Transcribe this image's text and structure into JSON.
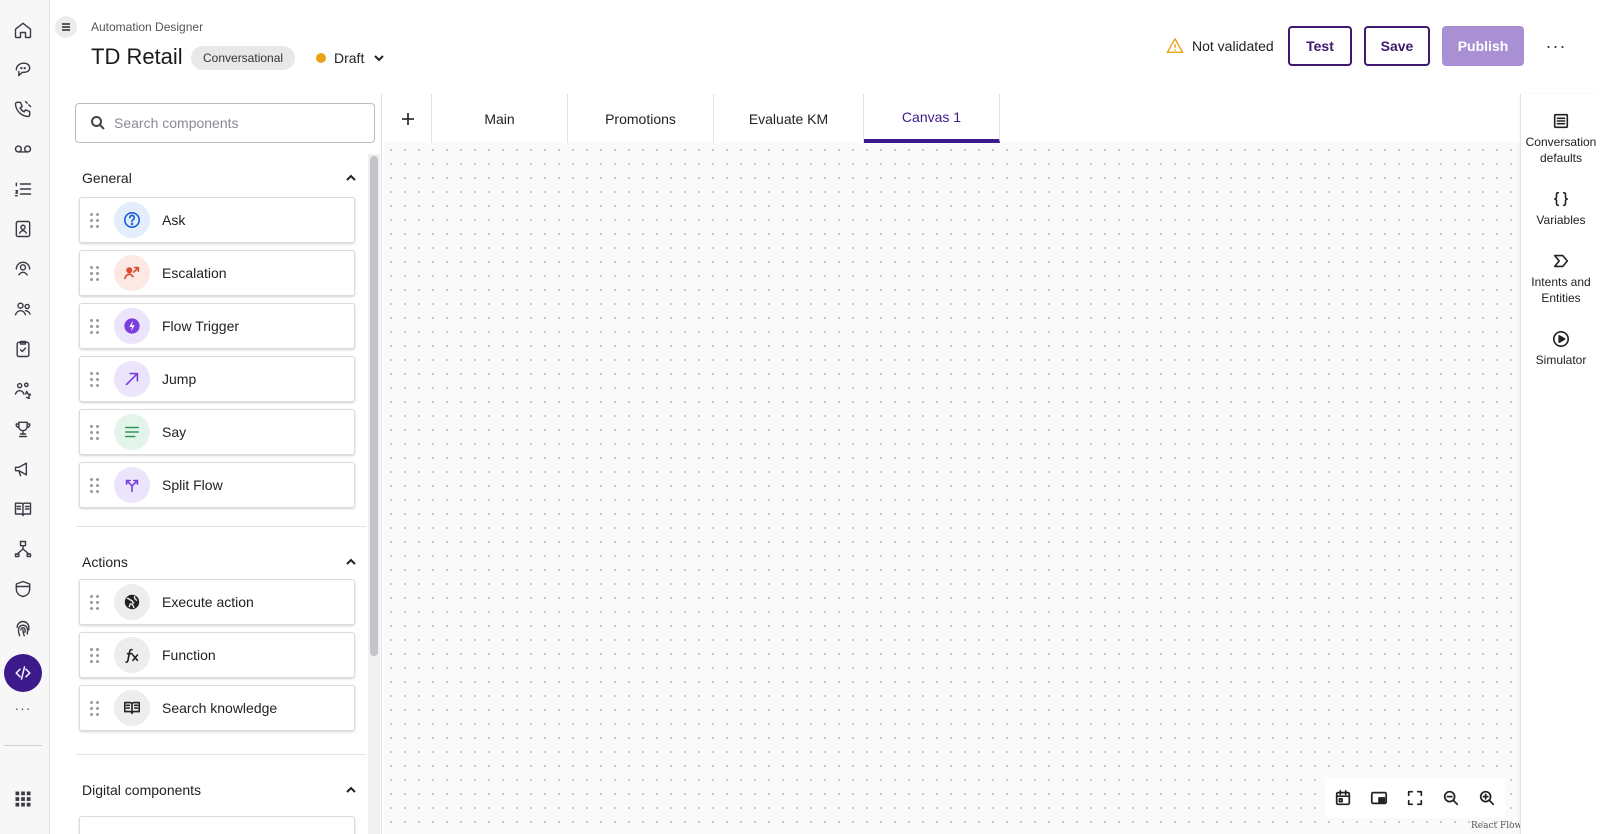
{
  "header": {
    "breadcrumb": "Automation Designer",
    "title": "TD Retail",
    "type_chip": "Conversational",
    "status": "Draft",
    "validation": "Not validated",
    "test_label": "Test",
    "save_label": "Save",
    "publish_label": "Publish",
    "more_label": "···"
  },
  "colors": {
    "brand": "#3d1a8c",
    "publish_disabled": "#a98fd3",
    "draft_dot": "#e8a317",
    "warning": "#e8a317"
  },
  "search": {
    "placeholder": "Search components",
    "value": ""
  },
  "sections": [
    {
      "title": "General",
      "items": [
        {
          "label": "Ask",
          "icon": "question-circle-icon",
          "color": "#1a5fd6",
          "bg": "#e4edfb"
        },
        {
          "label": "Escalation",
          "icon": "escalation-icon",
          "color": "#e0492b",
          "bg": "#fde9e4"
        },
        {
          "label": "Flow Trigger",
          "icon": "lightning-icon",
          "color": "#7a3de0",
          "bg": "#ece4fb"
        },
        {
          "label": "Jump",
          "icon": "arrow-up-right-icon",
          "color": "#7a3de0",
          "bg": "#ece4fb"
        },
        {
          "label": "Say",
          "icon": "text-lines-icon",
          "color": "#2e9a5a",
          "bg": "#e3f4ea"
        },
        {
          "label": "Split Flow",
          "icon": "split-icon",
          "color": "#7a3de0",
          "bg": "#ece4fb"
        }
      ]
    },
    {
      "title": "Actions",
      "items": [
        {
          "label": "Execute action",
          "icon": "globe-icon",
          "color": "#222222",
          "bg": "#ededef"
        },
        {
          "label": "Function",
          "icon": "function-icon",
          "color": "#222222",
          "bg": "#ededef"
        },
        {
          "label": "Search knowledge",
          "icon": "book-icon",
          "color": "#222222",
          "bg": "#ededef"
        }
      ]
    },
    {
      "title": "Digital components",
      "items": []
    }
  ],
  "tabs": [
    {
      "label": "Main",
      "active": false
    },
    {
      "label": "Promotions",
      "active": false
    },
    {
      "label": "Evaluate KM",
      "active": false
    },
    {
      "label": "Canvas 1",
      "active": true
    }
  ],
  "side_panel": [
    {
      "label": "Conversation defaults",
      "icon": "list-icon"
    },
    {
      "label": "Variables",
      "icon": "braces-icon"
    },
    {
      "label": "Intents and Entities",
      "icon": "intent-icon"
    },
    {
      "label": "Simulator",
      "icon": "play-circle-icon"
    }
  ],
  "canvas_controls": [
    "calendar-icon",
    "minimap-icon",
    "fit-view-icon",
    "zoom-out-icon",
    "zoom-in-icon"
  ],
  "attribution": "React Flow",
  "rail_icons": [
    "home-icon",
    "conversation-icon",
    "phone-icon",
    "voicemail-icon",
    "ordered-list-icon",
    "contact-card-icon",
    "agent-icon",
    "users-icon",
    "clipboard-icon",
    "team-icon",
    "trophy-icon",
    "megaphone-icon",
    "book-open-icon",
    "flow-icon",
    "shield-icon",
    "fingerprint-icon",
    "code-icon",
    "apps-grid-icon"
  ]
}
